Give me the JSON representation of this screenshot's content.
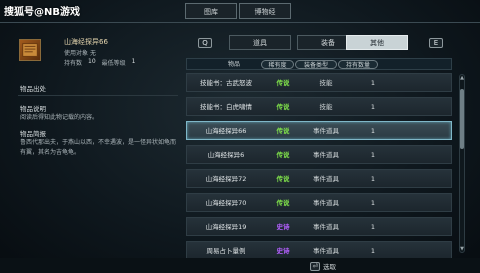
{
  "watermark": "搜狐号@NB游戏",
  "top_tabs": [
    {
      "label": "图库",
      "active": true
    },
    {
      "label": "博物经",
      "active": false
    }
  ],
  "item": {
    "name": "山海经探异66",
    "owner_label": "使用对象",
    "owner_value": "无",
    "stats": [
      {
        "label": "持有数",
        "value": "10"
      },
      {
        "label": "最低等级",
        "value": "1"
      }
    ]
  },
  "left_sections": {
    "source_title": "物品出处",
    "desc_title": "物品说明",
    "desc_text": "阅读后得知此物记载的内容。",
    "intro_title": "物品简报",
    "intro_text": "鲁西代那出夫，于燕山以西，不幸遇波，是一怪异状如龟而有翼，其名为吉龟龟。"
  },
  "nav_keys": {
    "prev": "Q",
    "next": "E"
  },
  "category_tabs": [
    {
      "label": "道具",
      "active": false
    },
    {
      "label": "装备",
      "active": false
    },
    {
      "label": "其他",
      "active": true
    }
  ],
  "table_headers": {
    "name": "物品",
    "quality": "稀有度",
    "type": "装备类型",
    "count": "持有数量"
  },
  "rows": [
    {
      "name": "技能书：古武怒波",
      "quality": "传说",
      "quality_color": "green",
      "type": "技能",
      "count": "1"
    },
    {
      "name": "技能书：白虎啸情",
      "quality": "传说",
      "quality_color": "green",
      "type": "技能",
      "count": "1"
    },
    {
      "name": "山海经探异66",
      "quality": "传说",
      "quality_color": "green",
      "type": "事件道具",
      "count": "1",
      "selected": true
    },
    {
      "name": "山海经探异6",
      "quality": "传说",
      "quality_color": "green",
      "type": "事件道具",
      "count": "1"
    },
    {
      "name": "山海经探异72",
      "quality": "传说",
      "quality_color": "green",
      "type": "事件道具",
      "count": "1"
    },
    {
      "name": "山海经探异70",
      "quality": "传说",
      "quality_color": "green",
      "type": "事件道具",
      "count": "1"
    },
    {
      "name": "山海经探异19",
      "quality": "史诗",
      "quality_color": "purple",
      "type": "事件道具",
      "count": "1"
    },
    {
      "name": "周易占卜量例",
      "quality": "史诗",
      "quality_color": "purple",
      "type": "事件道具",
      "count": "1"
    }
  ],
  "bottom_hint": {
    "key": "⏎",
    "label": "选取"
  }
}
